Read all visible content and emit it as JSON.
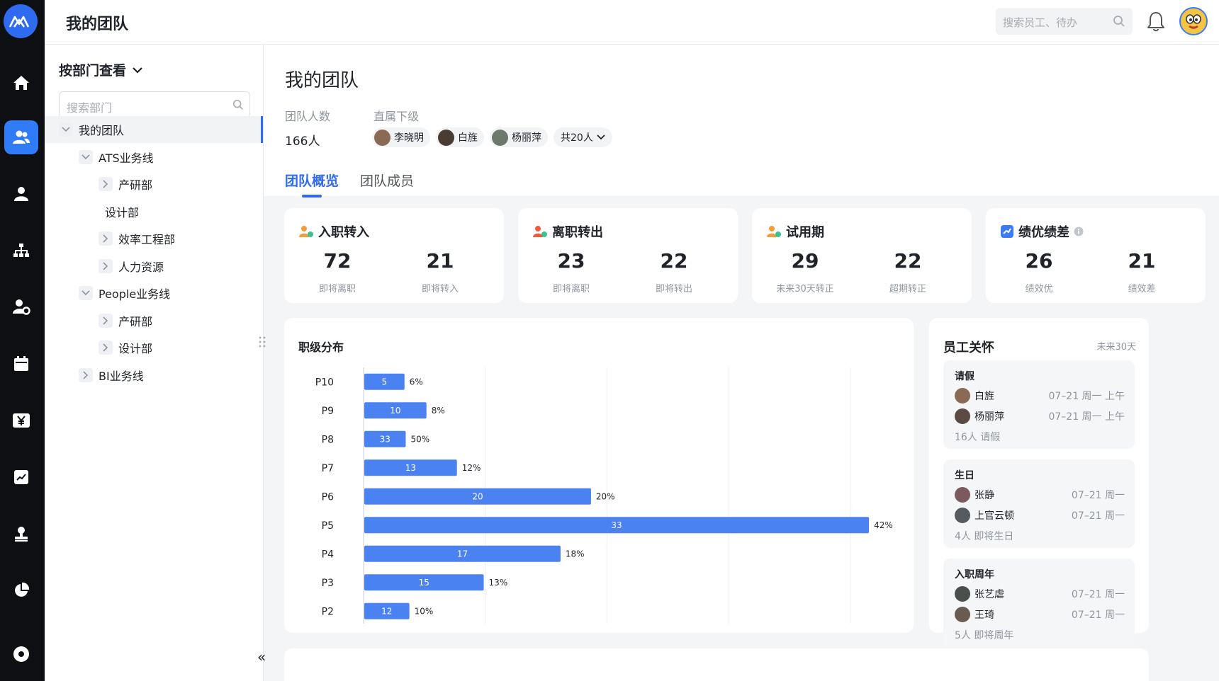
{
  "header": {
    "title": "我的团队",
    "search_placeholder": "搜索员工、待办"
  },
  "dept_panel": {
    "selector_label": "按部门查看",
    "search_placeholder": "搜索部门",
    "tree": [
      {
        "label": "我的团队",
        "level": 0,
        "toggle": "expanded",
        "active": true
      },
      {
        "label": "ATS业务线",
        "level": 1,
        "toggle": "expanded"
      },
      {
        "label": "产研部",
        "level": 2,
        "toggle": "collapsed"
      },
      {
        "label": "设计部",
        "level": 2,
        "toggle": "none"
      },
      {
        "label": "效率工程部",
        "level": 2,
        "toggle": "collapsed"
      },
      {
        "label": "人力资源",
        "level": 2,
        "toggle": "collapsed"
      },
      {
        "label": "People业务线",
        "level": 1,
        "toggle": "expanded"
      },
      {
        "label": "产研部",
        "level": 2,
        "toggle": "collapsed"
      },
      {
        "label": "设计部",
        "level": 2,
        "toggle": "collapsed"
      },
      {
        "label": "BI业务线",
        "level": 1,
        "toggle": "collapsed"
      }
    ],
    "collapse_label": "«"
  },
  "team": {
    "title": "我的团队",
    "size_label": "团队人数",
    "size_value": "166人",
    "reports_label": "直属下级",
    "reports": [
      {
        "name": "李晓明",
        "color": "#8a6a55"
      },
      {
        "name": "白旌",
        "color": "#4a3c33"
      },
      {
        "name": "杨丽萍",
        "color": "#6b7a6a"
      }
    ],
    "reports_more": "共20人"
  },
  "tabs": [
    {
      "label": "团队概览",
      "active": true
    },
    {
      "label": "团队成员",
      "active": false
    }
  ],
  "stats": [
    {
      "title": "入职转入",
      "icon": "person-add-icon",
      "icon_color": "#f29d38",
      "items": [
        {
          "value": "72",
          "label": "即将离职"
        },
        {
          "value": "21",
          "label": "即将转入"
        }
      ]
    },
    {
      "title": "离职转出",
      "icon": "person-leave-icon",
      "icon_color": "#f05a3c",
      "items": [
        {
          "value": "23",
          "label": "即将离职"
        },
        {
          "value": "22",
          "label": "即将转出"
        }
      ]
    },
    {
      "title": "试用期",
      "icon": "person-probation-icon",
      "icon_color": "#f29d38",
      "items": [
        {
          "value": "29",
          "label": "未来30天转正"
        },
        {
          "value": "22",
          "label": "超期转正"
        }
      ]
    },
    {
      "title": "绩优绩差",
      "icon": "performance-icon",
      "icon_color": "#3b7cf6",
      "items": [
        {
          "value": "26",
          "label": "绩效优"
        },
        {
          "value": "21",
          "label": "绩效差"
        }
      ]
    }
  ],
  "chart_title": "职级分布",
  "chart_data": {
    "type": "bar",
    "orientation": "horizontal",
    "title": "职级分布",
    "categories": [
      "P10",
      "P9",
      "P8",
      "P7",
      "P6",
      "P5",
      "P4",
      "P3",
      "P2"
    ],
    "values": [
      5,
      10,
      33,
      13,
      20,
      33,
      17,
      15,
      12
    ],
    "percent_labels": [
      "6%",
      "8%",
      "50%",
      "12%",
      "20%",
      "42%",
      "18%",
      "13%",
      "10%"
    ],
    "percent_values": [
      3.3,
      5.1,
      3.4,
      7.6,
      18.6,
      41.4,
      16.1,
      9.8,
      3.7
    ],
    "xlim": [
      0,
      50
    ],
    "xticks": [
      "0",
      "10%",
      "20%",
      "30%",
      "40%",
      "50%"
    ],
    "grid": true,
    "bar_color": "#4b82f1"
  },
  "care": {
    "title": "员工关怀",
    "range": "未来30天",
    "blocks": [
      {
        "title": "请假",
        "rows": [
          {
            "name": "白旌",
            "date": "07–21 周一 上午",
            "color": "#8a6a55"
          },
          {
            "name": "杨丽萍",
            "date": "07–21 周一 上午",
            "color": "#5a4a42"
          }
        ],
        "footer": "16人 请假"
      },
      {
        "title": "生日",
        "rows": [
          {
            "name": "张静",
            "date": "07–21 周一",
            "color": "#7b5a5e"
          },
          {
            "name": "上官云顿",
            "date": "07–21 周一",
            "color": "#555b60"
          }
        ],
        "footer": "4人 即将生日"
      },
      {
        "title": "入职周年",
        "rows": [
          {
            "name": "张艺虐",
            "date": "07–21 周一",
            "color": "#4a4f4c"
          },
          {
            "name": "王琦",
            "date": "07–21 周一",
            "color": "#6a5b50"
          }
        ],
        "footer": "5人 即将周年"
      }
    ]
  }
}
